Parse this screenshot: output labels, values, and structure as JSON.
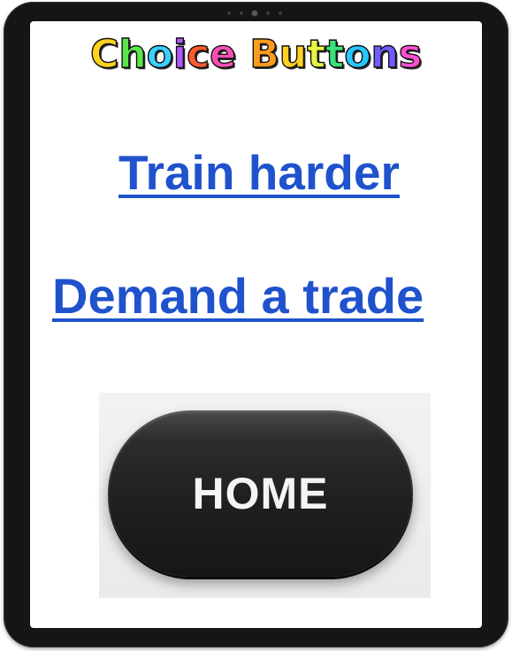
{
  "title": {
    "text": "Choice Buttons",
    "letters": [
      {
        "ch": "C",
        "color": "#ffd21f"
      },
      {
        "ch": "h",
        "color": "#5be64a"
      },
      {
        "ch": "o",
        "color": "#3ad0ff"
      },
      {
        "ch": "i",
        "color": "#b057ff"
      },
      {
        "ch": "c",
        "color": "#ff5a2e"
      },
      {
        "ch": "e",
        "color": "#ff4fb5"
      },
      {
        "ch": " ",
        "color": "#ffffff"
      },
      {
        "ch": "B",
        "color": "#ff9a1f"
      },
      {
        "ch": "u",
        "color": "#ffd21f"
      },
      {
        "ch": "t",
        "color": "#e9f542"
      },
      {
        "ch": "t",
        "color": "#38e27a"
      },
      {
        "ch": "o",
        "color": "#26c7ff"
      },
      {
        "ch": "n",
        "color": "#6f5bff"
      },
      {
        "ch": "s",
        "color": "#ff4fd0"
      }
    ]
  },
  "choices": [
    {
      "label": "Train harder"
    },
    {
      "label": "Demand a trade"
    }
  ],
  "home_button": {
    "label": "HOME"
  },
  "colors": {
    "link": "#1f52cc",
    "frame": "#151515",
    "button": "#1e1e1e"
  }
}
